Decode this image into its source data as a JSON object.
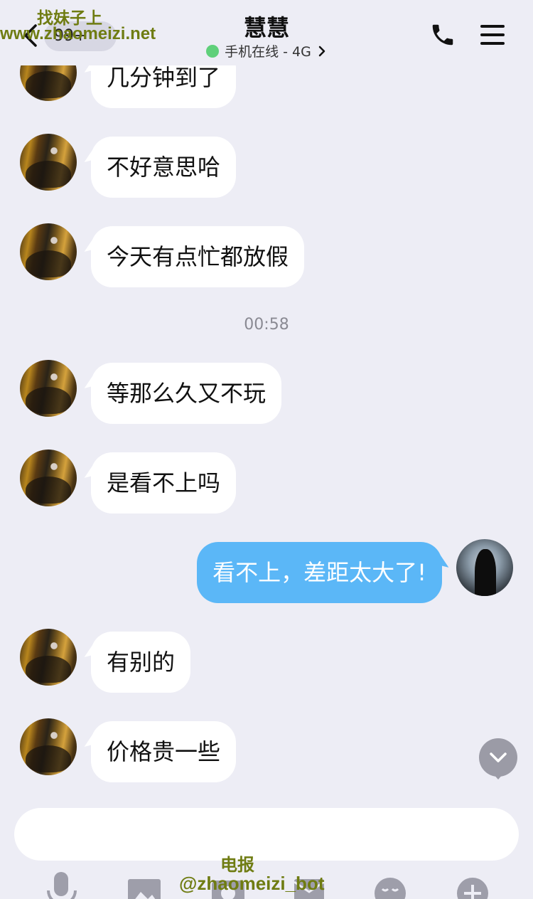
{
  "header": {
    "title": "慧慧",
    "unread_count": "99+",
    "status_text": "手机在线 - 4G",
    "status_color": "#5fd07a"
  },
  "watermarks": {
    "top_text": "找妹子上",
    "top_url": "www.zhaomeizi.net",
    "bottom_label": "电报",
    "bottom_handle": "@zhaomeizi_bot"
  },
  "messages": [
    {
      "sender": "contact",
      "text": "几分钟到了"
    },
    {
      "sender": "contact",
      "text": "不好意思哈"
    },
    {
      "sender": "contact",
      "text": "今天有点忙都放假"
    },
    {
      "type": "timestamp",
      "text": "00:58"
    },
    {
      "sender": "contact",
      "text": "等那么久又不玩"
    },
    {
      "sender": "contact",
      "text": "是看不上吗"
    },
    {
      "sender": "me",
      "text": "看不上，差距太大了!"
    },
    {
      "sender": "contact",
      "text": "有别的"
    },
    {
      "sender": "contact",
      "text": "价格贵一些"
    }
  ],
  "input": {
    "value": "",
    "placeholder": ""
  },
  "toolbar": {
    "icons": [
      "microphone-icon",
      "image-icon",
      "camera-icon",
      "red-packet-icon",
      "emoji-icon",
      "plus-icon"
    ]
  },
  "colors": {
    "background": "#ededf5",
    "outgoing_bubble": "#5bb7f7",
    "incoming_bubble": "#ffffff",
    "watermark": "#6f7c12"
  }
}
